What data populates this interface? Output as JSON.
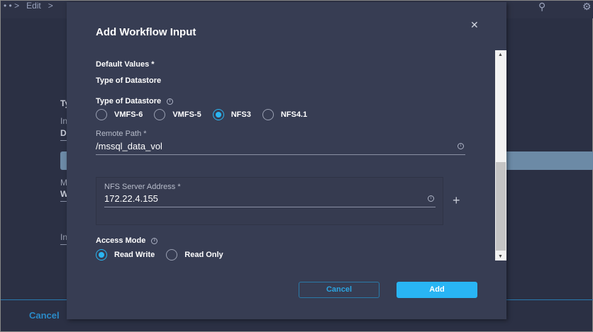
{
  "topbar": {
    "crumbs": [
      "• • >",
      "Edit",
      ">"
    ]
  },
  "background": {
    "labels": [
      "Ty",
      "In",
      "D",
      "M",
      "W",
      "In"
    ],
    "cancel": "Cancel"
  },
  "modal": {
    "title": "Add Workflow Input",
    "default_values": "Default Values *",
    "type_heading": "Type of Datastore",
    "type_label": "Type of Datastore",
    "datastore_options": [
      {
        "label": "VMFS-6",
        "selected": false
      },
      {
        "label": "VMFS-5",
        "selected": false
      },
      {
        "label": "NFS3",
        "selected": true
      },
      {
        "label": "NFS4.1",
        "selected": false
      }
    ],
    "remote_path_label": "Remote Path *",
    "remote_path_value": "/mssql_data_vol",
    "nfs_label": "NFS Server Address *",
    "nfs_value": "172.22.4.155",
    "access_mode_label": "Access Mode",
    "access_options": [
      {
        "label": "Read Write",
        "selected": true
      },
      {
        "label": "Read Only",
        "selected": false
      }
    ],
    "cancel": "Cancel",
    "add": "Add"
  },
  "colors": {
    "accent": "#29b5f4",
    "modal_bg": "#373d53",
    "page_bg": "#2b3044"
  }
}
